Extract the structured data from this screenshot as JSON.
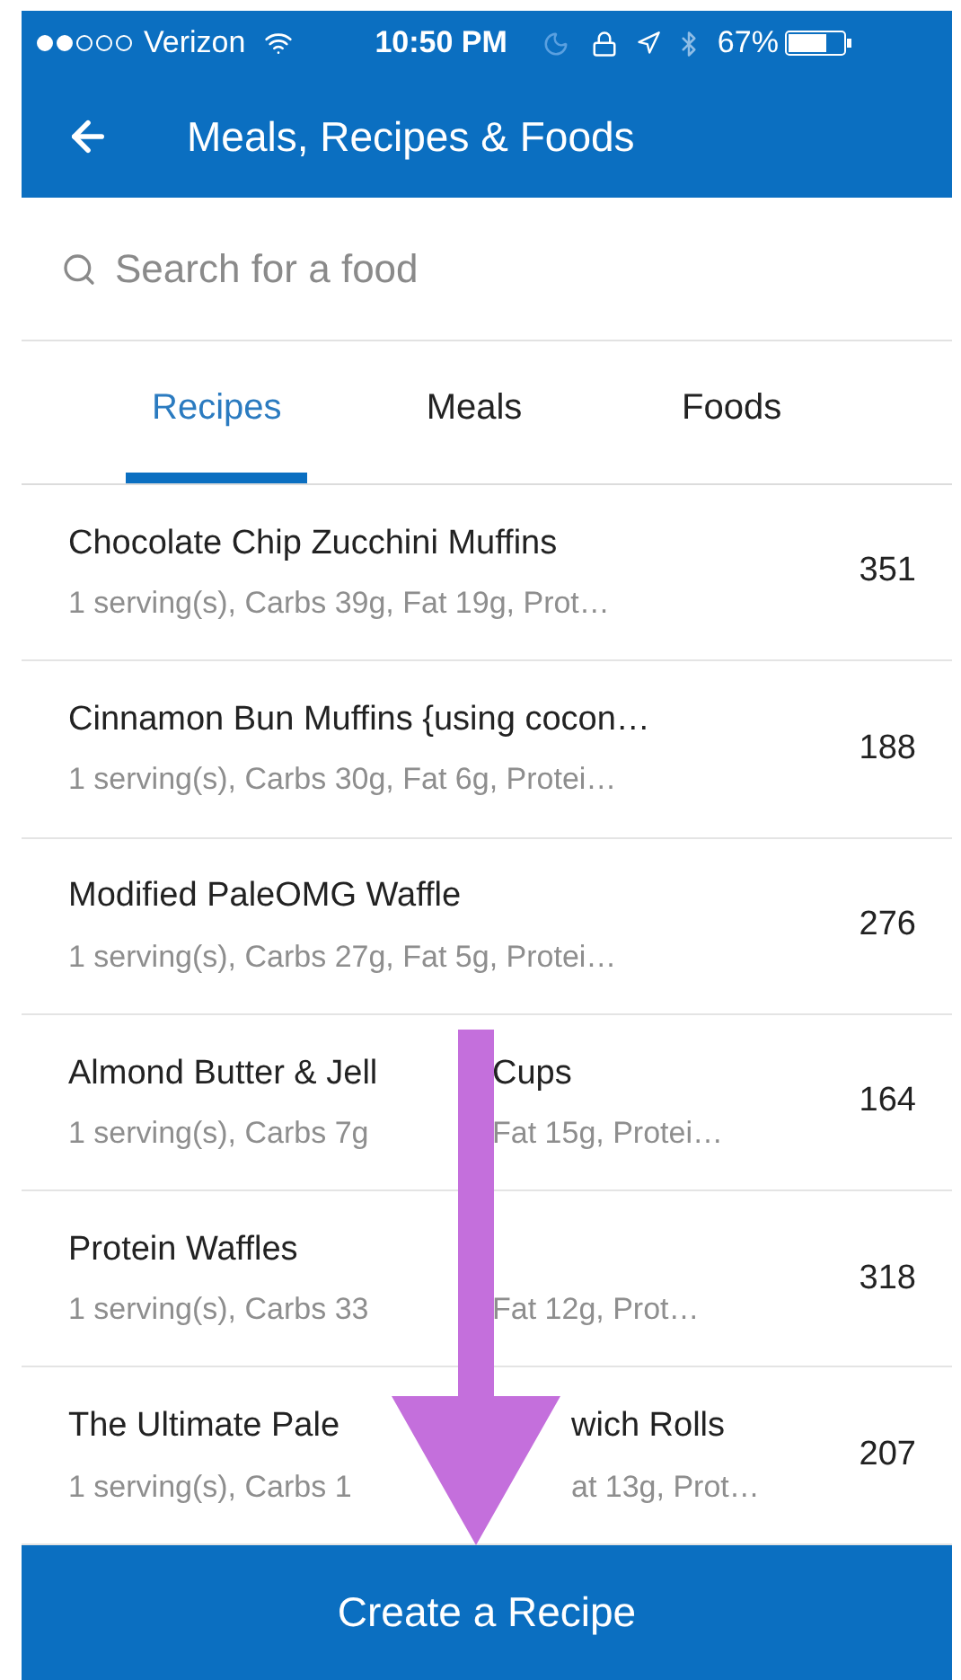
{
  "status_bar": {
    "carrier": "Verizon",
    "time": "10:50 PM",
    "battery": "67%"
  },
  "nav": {
    "title": "Meals, Recipes & Foods"
  },
  "search": {
    "placeholder": "Search for a food"
  },
  "tabs": [
    {
      "label": "Recipes",
      "selected": true
    },
    {
      "label": "Meals",
      "selected": false
    },
    {
      "label": "Foods",
      "selected": false
    }
  ],
  "items": [
    {
      "title": [
        "Chocolate Chip Zucchini Muffins"
      ],
      "details": [
        "1 serving(s), Carbs 39g, Fat 19g, Prot…"
      ],
      "calories": "351"
    },
    {
      "title": [
        "Cinnamon Bun Muffins {using cocon…"
      ],
      "details": [
        "1 serving(s), Carbs 30g, Fat 6g, Protei…"
      ],
      "calories": "188"
    },
    {
      "title": [
        "Modified PaleOMG Waffle"
      ],
      "details": [
        "1 serving(s), Carbs 27g, Fat 5g, Protei…"
      ],
      "calories": "276"
    },
    {
      "kind": "shaft",
      "title": [
        "Almond Butter & Jell",
        "Cups"
      ],
      "details": [
        "1 serving(s), Carbs 7g",
        "Fat 15g, Protei…"
      ],
      "calories": "164"
    },
    {
      "kind": "shaft",
      "title": [
        "Protein Waffles"
      ],
      "details": [
        "1 serving(s), Carbs 33",
        "Fat 12g, Prot…"
      ],
      "calories": "318"
    },
    {
      "kind": "head",
      "title": [
        "The Ultimate Pale",
        "wich Rolls"
      ],
      "details": [
        "1 serving(s), Carbs 1",
        "at 13g, Prot…"
      ],
      "calories": "207"
    }
  ],
  "action_button": "Create a Recipe"
}
